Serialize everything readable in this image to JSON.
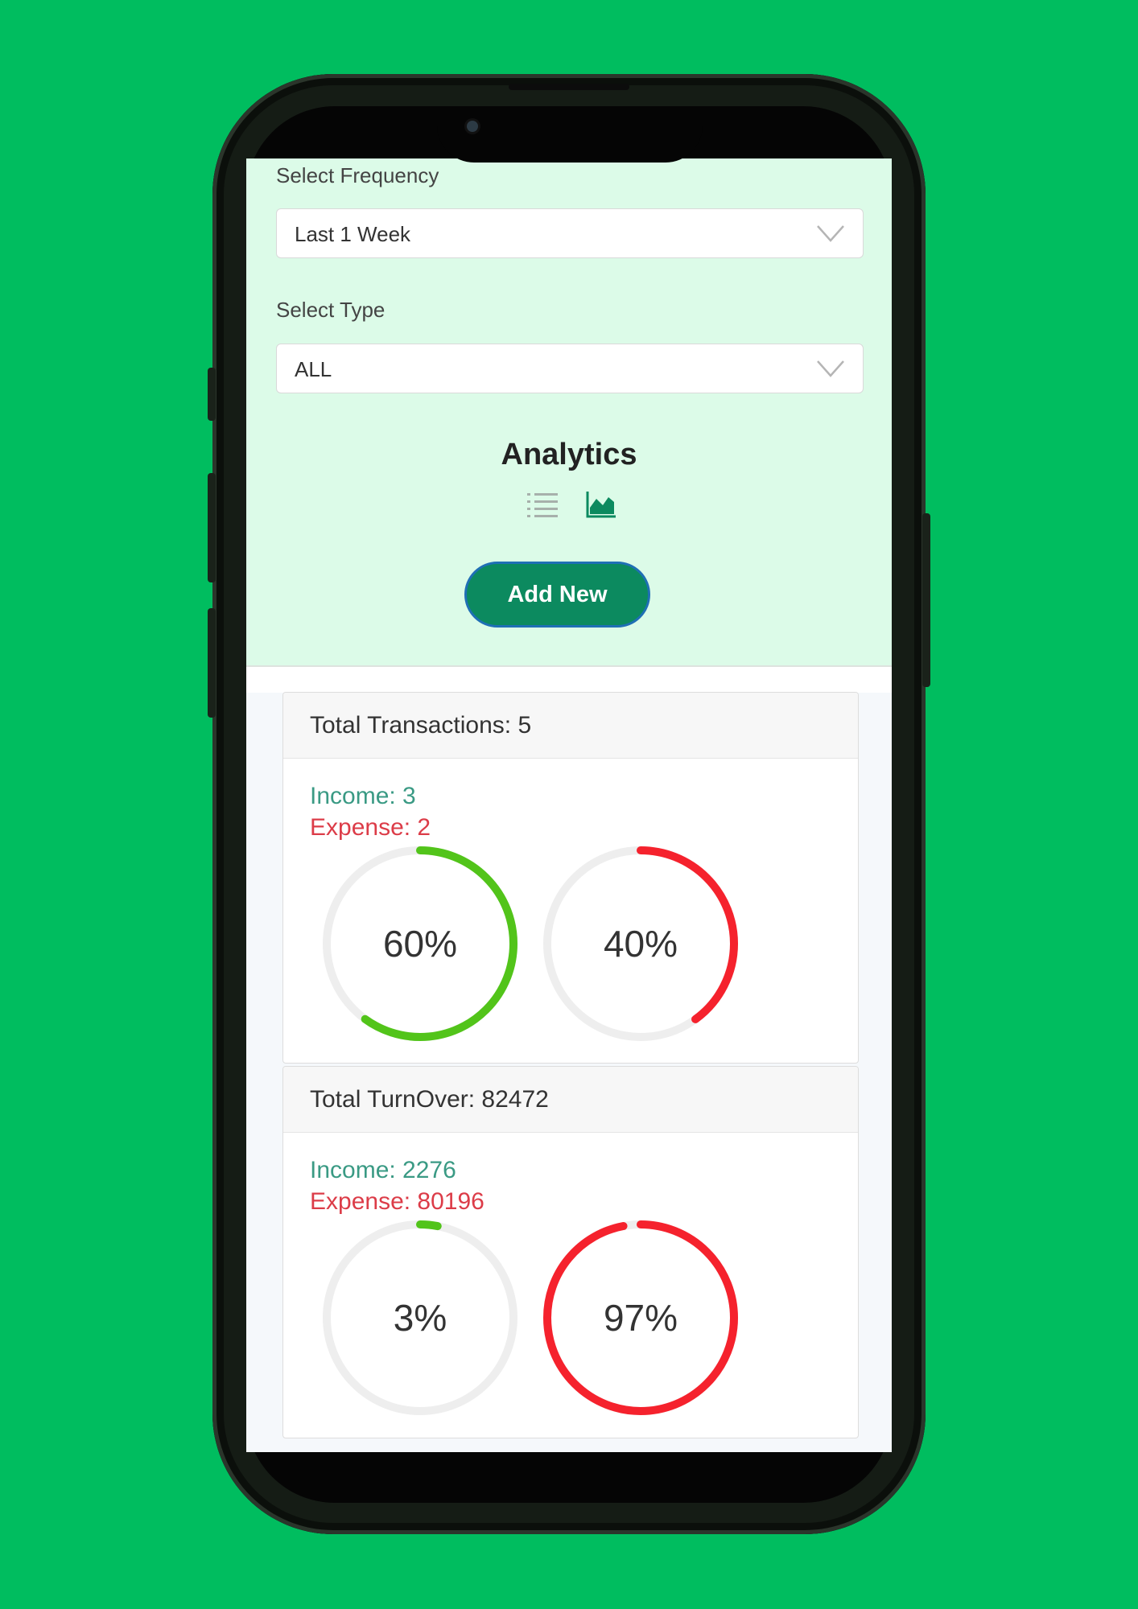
{
  "filters": {
    "frequency_label": "Select Frequency",
    "frequency_value": "Last 1 Week",
    "type_label": "Select Type",
    "type_value": "ALL"
  },
  "analytics": {
    "title": "Analytics",
    "view_icons": [
      "list-icon",
      "area-chart-icon"
    ],
    "add_button": "Add New"
  },
  "transactions_card": {
    "heading": "Total Transactions: 5",
    "income": "Income: 3",
    "expense": "Expense: 2",
    "income_percent": 60,
    "expense_percent": 40,
    "income_label": "60%",
    "expense_label": "40%"
  },
  "turnover_card": {
    "heading": "Total TurnOver: 82472",
    "income": "Income: 2276",
    "expense": "Expense: 80196",
    "income_percent": 3,
    "expense_percent": 97,
    "income_label": "3%",
    "expense_label": "97%"
  },
  "colors": {
    "background": "#00bd5f",
    "top_panel": "#dcfbe8",
    "button": "#0c8a5f",
    "income": "#52c41a",
    "expense": "#f5222d",
    "income_text": "#3a9a84",
    "expense_text": "#dc3c48"
  }
}
